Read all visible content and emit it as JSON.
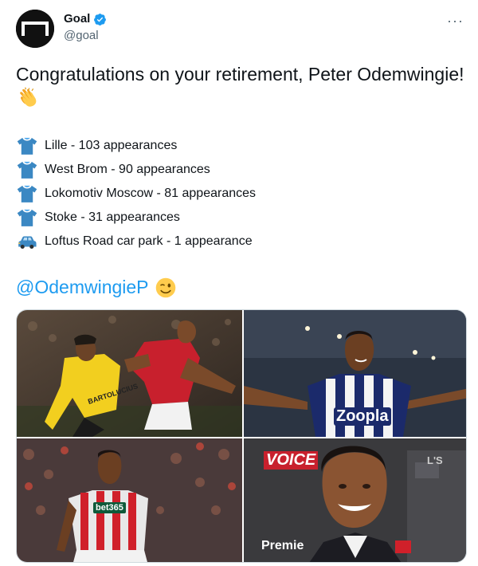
{
  "account": {
    "display_name": "Goal",
    "handle": "@goal"
  },
  "tweet": {
    "headline": "Congratulations on your retirement, Peter Odemwingie!",
    "clap_icon": "clapping-hands-emoji",
    "list": [
      {
        "icon": "tshirt-emoji",
        "text": "Lille - 103 appearances"
      },
      {
        "icon": "tshirt-emoji",
        "text": "West Brom - 90 appearances"
      },
      {
        "icon": "tshirt-emoji",
        "text": "Lokomotiv Moscow - 81 appearances"
      },
      {
        "icon": "tshirt-emoji",
        "text": "Stoke - 31 appearances"
      },
      {
        "icon": "car-emoji",
        "text": "Loftus Road car park - 1 appearance"
      }
    ],
    "mention": "@OdemwingieP",
    "wink_icon": "winking-face-emoji"
  },
  "media": {
    "photo_1": {
      "shirt_text": "BARTOLUCIUS"
    },
    "photo_2": {
      "shirt_text": "Zoopla"
    },
    "photo_3": {
      "shirt_text": "bet365"
    },
    "photo_4": {
      "board_text_1": "VOICE",
      "board_text_2": "Premie",
      "board_text_3": "L'S"
    }
  },
  "colors": {
    "link": "#1d9bf0",
    "secondary_text": "#536471",
    "tshirt": "#3b88c3"
  }
}
